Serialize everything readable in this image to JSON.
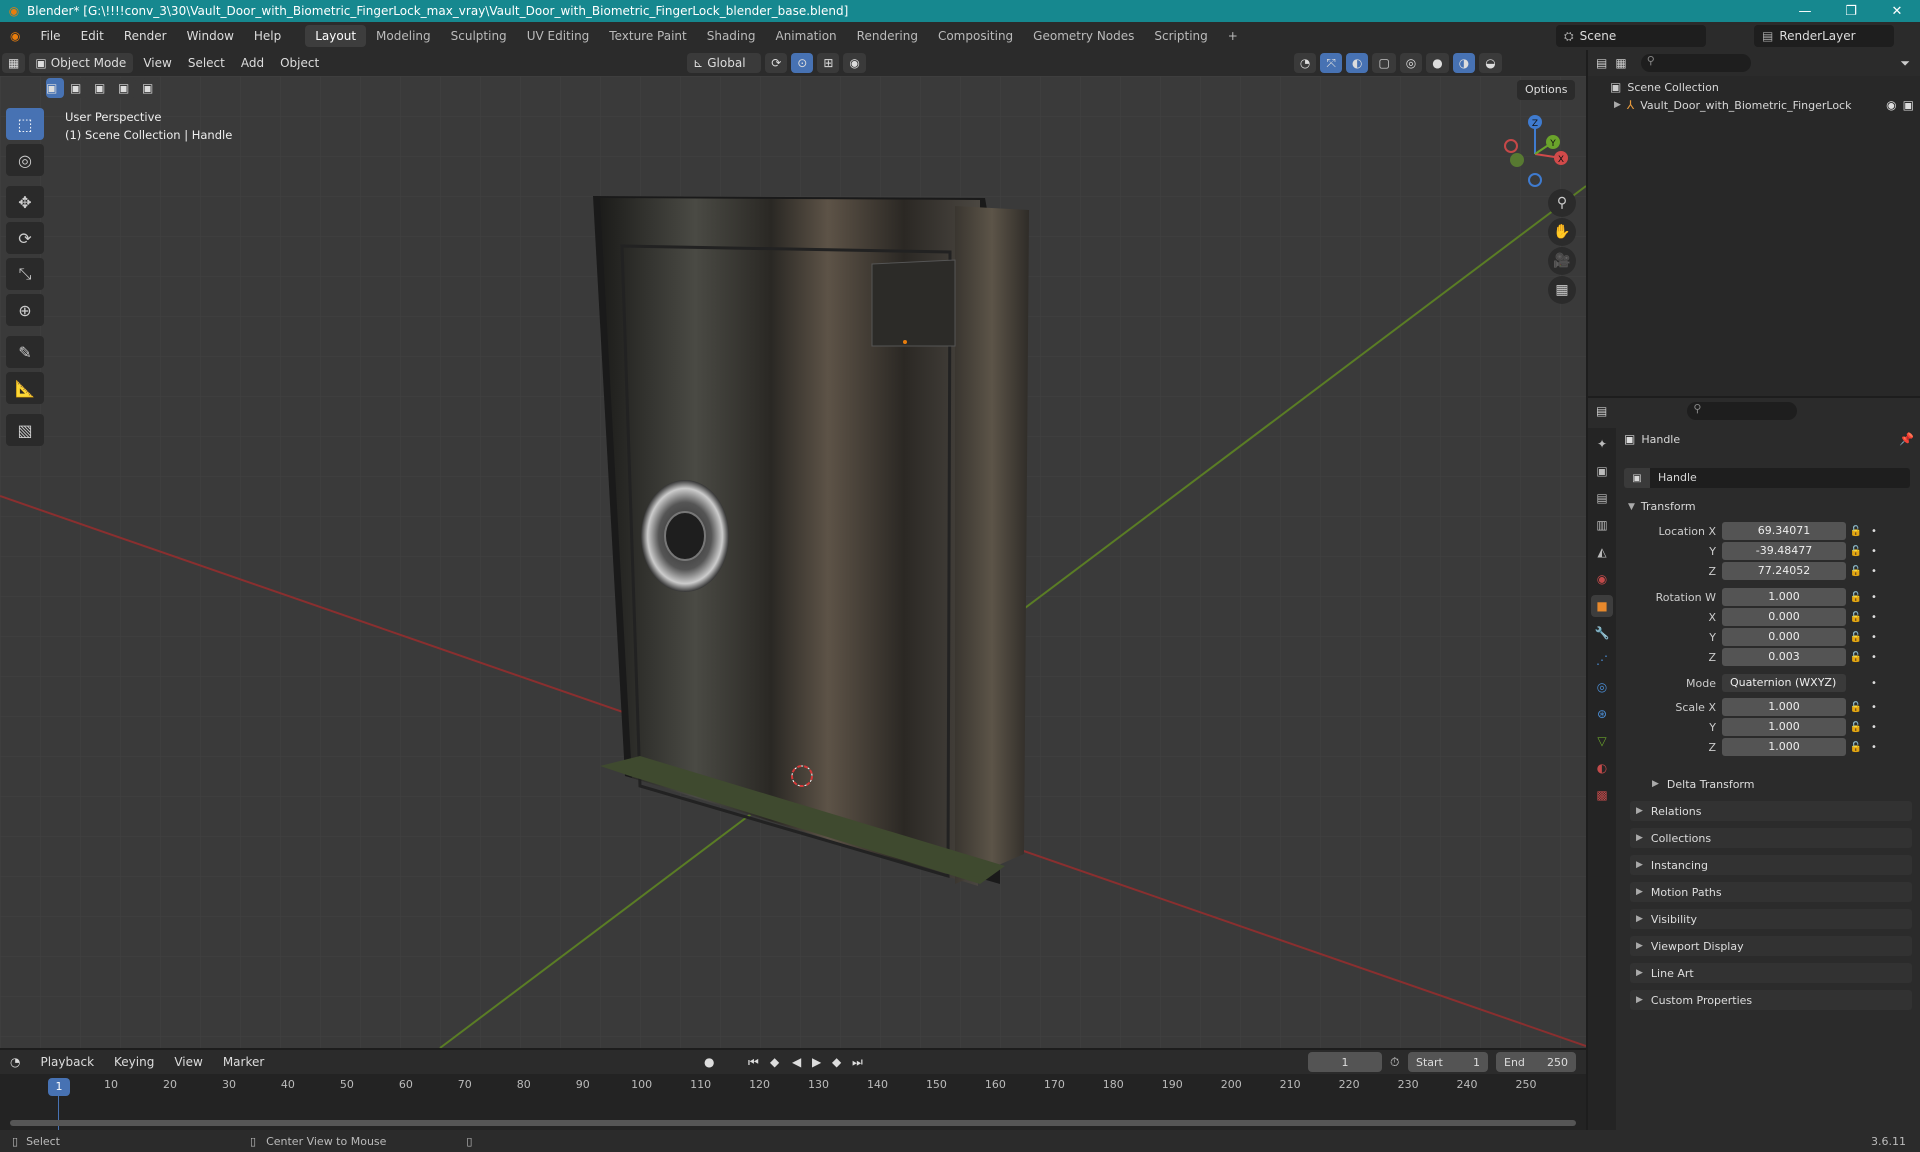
{
  "title_bar": {
    "title": "Blender* [G:\\!!!!conv_3\\30\\Vault_Door_with_Biometric_FingerLock_max_vray\\Vault_Door_with_Biometric_FingerLock_blender_base.blend]",
    "minimize": "—",
    "maximize": "❐",
    "close": "✕"
  },
  "menus": [
    "File",
    "Edit",
    "Render",
    "Window",
    "Help"
  ],
  "workspaces": [
    "Layout",
    "Modeling",
    "Sculpting",
    "UV Editing",
    "Texture Paint",
    "Shading",
    "Animation",
    "Rendering",
    "Compositing",
    "Geometry Nodes",
    "Scripting",
    "+"
  ],
  "scene": {
    "name": "Scene",
    "render_layer": "RenderLayer"
  },
  "viewport_header": {
    "mode": "Object Mode",
    "menus": [
      "View",
      "Select",
      "Add",
      "Object"
    ],
    "transform_orientation": "Global",
    "options": "Options"
  },
  "viewport": {
    "perspective": "User Perspective",
    "collection_info": "(1) Scene Collection | Handle",
    "gizmo": {
      "x": "X",
      "y": "Y",
      "z": "Z"
    }
  },
  "outliner": {
    "scene_collection": "Scene Collection",
    "items": [
      "Vault_Door_with_Biometric_FingerLock"
    ]
  },
  "properties": {
    "object_name": "Handle",
    "data_name": "Handle",
    "transform_header": "Transform",
    "location": {
      "label": "Location X",
      "x": "69.34071",
      "y": "-39.48477",
      "z": "77.24052"
    },
    "rotation": {
      "label": "Rotation W",
      "w": "1.000",
      "x": "0.000",
      "y": "0.000",
      "z": "0.003"
    },
    "mode": {
      "label": "Mode",
      "value": "Quaternion (WXYZ)"
    },
    "scale": {
      "label": "Scale X",
      "x": "1.000",
      "y": "1.000",
      "z": "1.000"
    },
    "axis_labels": {
      "x": "X",
      "y": "Y",
      "z": "Z"
    },
    "delta_transform": "Delta Transform",
    "sections": [
      "Relations",
      "Collections",
      "Instancing",
      "Motion Paths",
      "Visibility",
      "Viewport Display",
      "Line Art",
      "Custom Properties"
    ]
  },
  "timeline": {
    "menus": [
      "Playback",
      "Keying",
      "View",
      "Marker"
    ],
    "current_frame": "1",
    "start_label": "Start",
    "start": "1",
    "end_label": "End",
    "end": "250",
    "ticks": [
      "1",
      "10",
      "20",
      "30",
      "40",
      "50",
      "60",
      "70",
      "80",
      "90",
      "100",
      "110",
      "120",
      "130",
      "140",
      "150",
      "160",
      "170",
      "180",
      "190",
      "200",
      "210",
      "220",
      "230",
      "240",
      "250"
    ]
  },
  "status_bar": {
    "select": "Select",
    "center_view": "Center View to Mouse",
    "version": "3.6.11"
  },
  "colors": {
    "accent": "#4772b3",
    "titlebar": "#16888f",
    "x_axis": "#c23b3b",
    "y_axis": "#6b9b28"
  }
}
